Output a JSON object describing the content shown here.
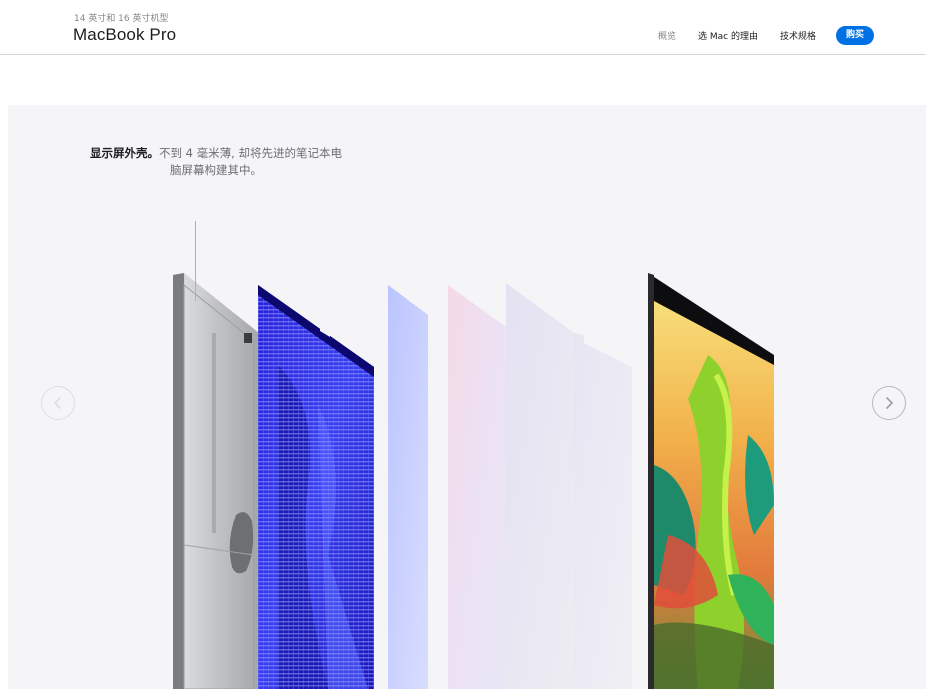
{
  "nav": {
    "subtitle": "14 英寸和 16 英寸机型",
    "title": "MacBook Pro",
    "links": [
      {
        "label": "概览",
        "current": true
      },
      {
        "label": "选 Mac 的理由",
        "current": false
      },
      {
        "label": "技术规格",
        "current": false
      }
    ],
    "buy_label": "购买"
  },
  "gallery": {
    "caption_strong": "显示屏外壳。",
    "caption_rest": "不到 4 毫米薄, 却将先进的笔记本电脑屏幕构建其中。",
    "prev_icon": "chevron-left-icon",
    "next_icon": "chevron-right-icon"
  },
  "colors": {
    "accent": "#0071e3",
    "stage_background": "#f5f5f7"
  }
}
